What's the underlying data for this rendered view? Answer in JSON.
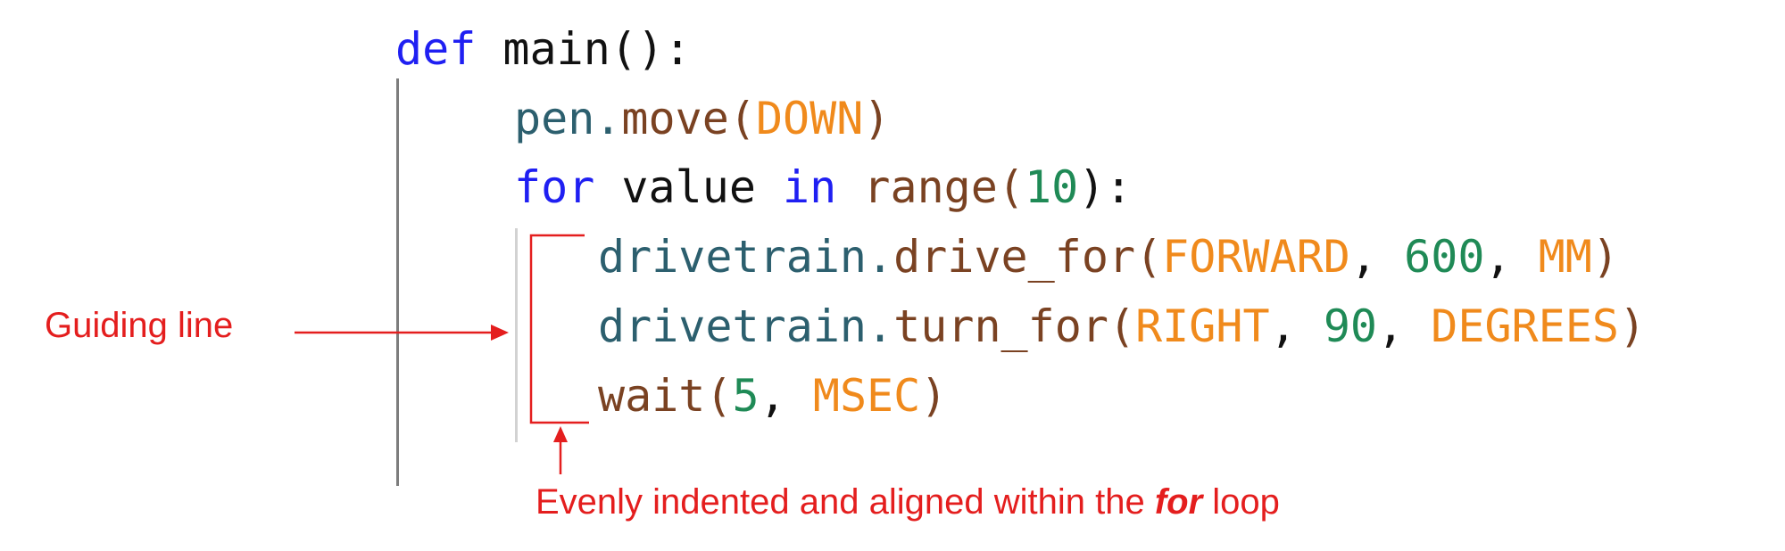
{
  "code": {
    "line1": {
      "kw": "def",
      "name": " main():"
    },
    "line2": {
      "obj": "pen.",
      "fn": "move(",
      "const": "DOWN",
      "close": ")"
    },
    "line3": {
      "kw1": "for",
      "mid": " value ",
      "kw2": "in",
      "sp": " ",
      "fn": "range(",
      "num": "10",
      "close": "):"
    },
    "line4": {
      "obj": "drivetrain.",
      "fn": "drive_for(",
      "c1": "FORWARD",
      "sep1": ", ",
      "num": "600",
      "sep2": ", ",
      "c2": "MM",
      "close": ")"
    },
    "line5": {
      "obj": "drivetrain.",
      "fn": "turn_for(",
      "c1": "RIGHT",
      "sep1": ", ",
      "num": "90",
      "sep2": ", ",
      "c2": "DEGREES",
      "close": ")"
    },
    "line6": {
      "fn": "wait(",
      "num": "5",
      "sep": ", ",
      "c": "MSEC",
      "close": ")"
    }
  },
  "annotations": {
    "guiding_line": "Guiding line",
    "indent_note_pre": "Evenly indented and aligned within the ",
    "indent_note_em": "for",
    "indent_note_post": " loop"
  },
  "colors": {
    "keyword": "#1f1ff2",
    "object": "#2c5f6e",
    "function": "#7a4222",
    "constant": "#f08a1c",
    "number": "#1f8a56",
    "annotation": "#e41e1e"
  }
}
